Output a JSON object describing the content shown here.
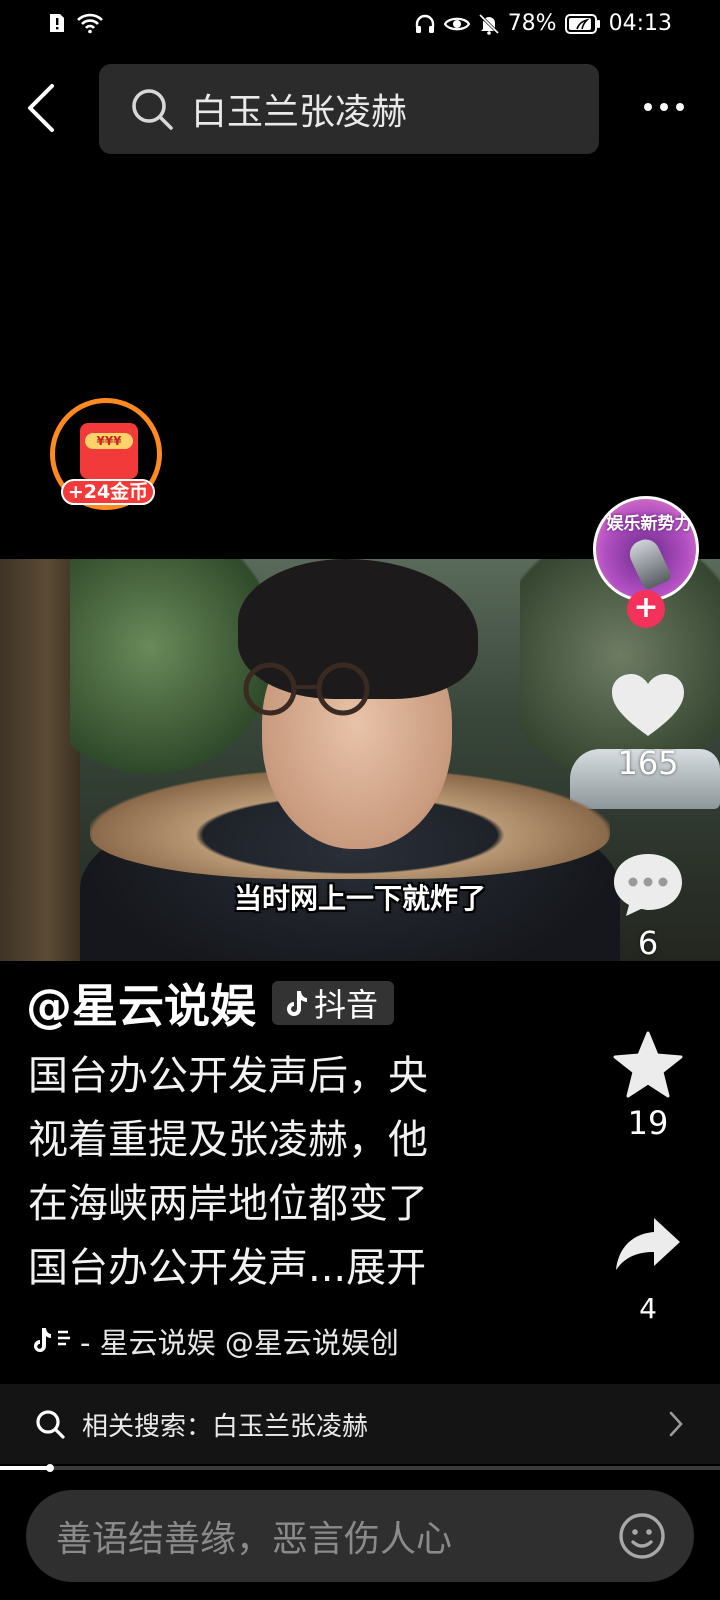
{
  "status_bar": {
    "battery": "78%",
    "time": "04:13"
  },
  "top_bar": {
    "search_query": "白玉兰张凌赫"
  },
  "coin_widget": {
    "label": "+24金币",
    "envelope_text": "¥¥¥"
  },
  "video": {
    "subtitle": "当时网上一下就炸了"
  },
  "creator_avatar": {
    "text": "娱乐新势力",
    "follow_symbol": "+"
  },
  "actions": {
    "likes": "165",
    "comments": "6",
    "favorites": "19",
    "shares": "4"
  },
  "post": {
    "author": "@星云说娱",
    "source_tag": "抖音",
    "description_lines": [
      "国台办公开发声后，央",
      "视着重提及张凌赫，他",
      "在海峡两岸地位都变了",
      "国台办公开发声...展开"
    ],
    "music_text": "- 星云说娱    @星云说娱创"
  },
  "related_search": {
    "label": "相关搜索：白玉兰张凌赫"
  },
  "playback": {
    "progress_fraction": 0.07
  },
  "comment_bar": {
    "placeholder": "善语结善缘，恶言伤人心"
  },
  "colors": {
    "background": "#000000",
    "accent_red": "#f2325a",
    "coin_orange": "#ff8a1f"
  }
}
